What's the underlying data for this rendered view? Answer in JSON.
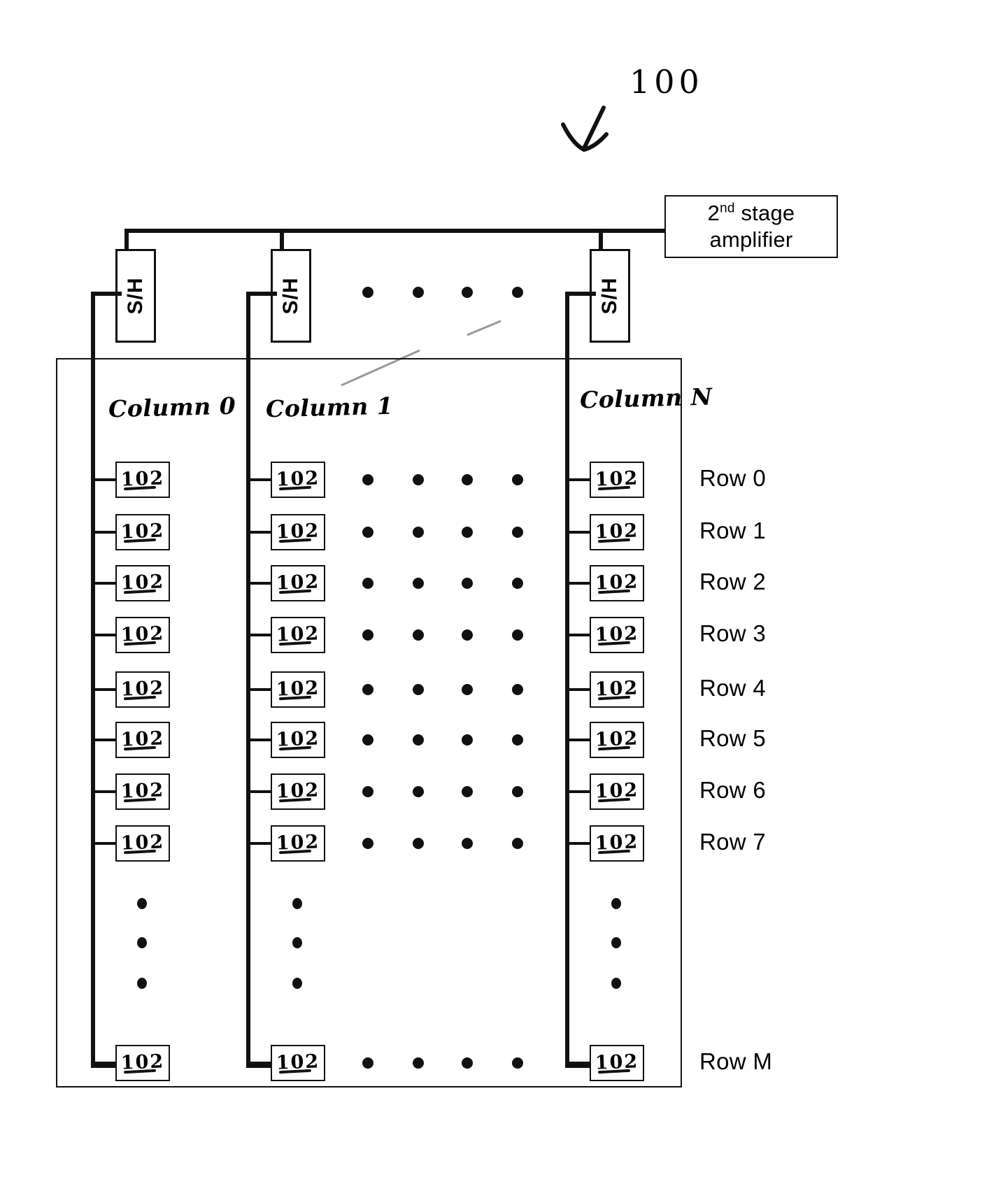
{
  "figure": {
    "reference_numeral": "100",
    "type": "patent-figure",
    "ink_color": "#111111",
    "background_color": "#ffffff"
  },
  "amplifier": {
    "name": "second-stage-amplifier",
    "line1_prefix": "2",
    "line1_sup": "nd",
    "line1_suffix": " stage",
    "line2": "amplifier"
  },
  "sample_hold": {
    "label": "S/H",
    "count_visible": 3,
    "instances": [
      {
        "label": "S/H",
        "column": "Column 0"
      },
      {
        "label": "S/H",
        "column": "Column 1"
      },
      {
        "label": "S/H",
        "column": "Column N"
      }
    ]
  },
  "columns": [
    {
      "id": "col0",
      "label": "Column 0"
    },
    {
      "id": "col1",
      "label": "Column 1"
    },
    {
      "id": "colN",
      "label": "Column N"
    }
  ],
  "rows": [
    {
      "id": "row0",
      "label": "Row 0"
    },
    {
      "id": "row1",
      "label": "Row 1"
    },
    {
      "id": "row2",
      "label": "Row 2"
    },
    {
      "id": "row3",
      "label": "Row 3"
    },
    {
      "id": "row4",
      "label": "Row 4"
    },
    {
      "id": "row5",
      "label": "Row 5"
    },
    {
      "id": "row6",
      "label": "Row 6"
    },
    {
      "id": "row7",
      "label": "Row 7"
    },
    {
      "id": "rowM",
      "label": "Row M"
    }
  ],
  "pixel_cell": {
    "reference_numeral": "102",
    "underlined": true,
    "description": "pixel circuit block"
  },
  "cells": {
    "col0": [
      "102",
      "102",
      "102",
      "102",
      "102",
      "102",
      "102",
      "102",
      "102"
    ],
    "col1": [
      "102",
      "102",
      "102",
      "102",
      "102",
      "102",
      "102",
      "102",
      "102"
    ],
    "colN": [
      "102",
      "102",
      "102",
      "102",
      "102",
      "102",
      "102",
      "102",
      "102"
    ]
  },
  "ellipsis": {
    "glyph": "•",
    "horizontal_between_columns": true,
    "vertical_between_rows": true
  }
}
